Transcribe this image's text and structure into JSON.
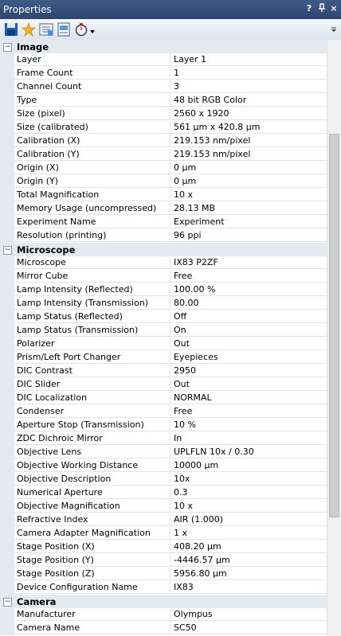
{
  "window": {
    "title": "Properties",
    "help_label": "?",
    "pin_label": "ᵖ",
    "close_label": "×"
  },
  "toolbar": {
    "icons": [
      "save-icon",
      "new-icon",
      "properties-icon",
      "export-icon",
      "timer-icon"
    ],
    "overflow_icon": "dropdown-overflow-icon"
  },
  "colors": {
    "title_bar": "#2f4a74",
    "category_bg": "#e4e9f1",
    "grid_line": "#e0e3e8"
  },
  "sections": [
    {
      "title": "Image",
      "rows": [
        {
          "name": "Layer",
          "value": "Layer 1"
        },
        {
          "name": "Frame Count",
          "value": "1"
        },
        {
          "name": "Channel Count",
          "value": "3"
        },
        {
          "name": "Type",
          "value": "48 bit RGB Color"
        },
        {
          "name": "Size (pixel)",
          "value": "2560 x 1920"
        },
        {
          "name": "Size (calibrated)",
          "value": "561 µm x 420.8 µm"
        },
        {
          "name": "Calibration (X)",
          "value": "219.153 nm/pixel"
        },
        {
          "name": "Calibration (Y)",
          "value": "219.153 nm/pixel"
        },
        {
          "name": "Origin (X)",
          "value": "0 µm"
        },
        {
          "name": "Origin (Y)",
          "value": "0 µm"
        },
        {
          "name": "Total Magnification",
          "value": "10 x"
        },
        {
          "name": "Memory Usage (uncompressed)",
          "value": "28.13 MB"
        },
        {
          "name": "Experiment Name",
          "value": "Experiment"
        },
        {
          "name": "Resolution (printing)",
          "value": "96 ppi"
        }
      ]
    },
    {
      "title": "Microscope",
      "rows": [
        {
          "name": "Microscope",
          "value": "IX83 P2ZF"
        },
        {
          "name": "Mirror Cube",
          "value": "Free"
        },
        {
          "name": "Lamp Intensity (Reflected)",
          "value": "100.00 %"
        },
        {
          "name": "Lamp Intensity (Transmission)",
          "value": "80.00"
        },
        {
          "name": "Lamp Status (Reflected)",
          "value": "Off"
        },
        {
          "name": "Lamp Status (Transmission)",
          "value": "On"
        },
        {
          "name": "Polarizer",
          "value": "Out"
        },
        {
          "name": "Prism/Left Port Changer",
          "value": "Eyepieces"
        },
        {
          "name": "DIC Contrast",
          "value": "2950"
        },
        {
          "name": "DIC Slider",
          "value": "Out"
        },
        {
          "name": "DIC Localization",
          "value": "NORMAL"
        },
        {
          "name": "Condenser",
          "value": "Free"
        },
        {
          "name": "Aperture Stop (Transmission)",
          "value": "10 %"
        },
        {
          "name": "ZDC Dichroic Mirror",
          "value": "In"
        },
        {
          "name": "Objective Lens",
          "value": "UPLFLN 10x / 0.30"
        },
        {
          "name": "Objective Working Distance",
          "value": "10000 µm"
        },
        {
          "name": "Objective Description",
          "value": "10x"
        },
        {
          "name": "Numerical Aperture",
          "value": "0.3"
        },
        {
          "name": "Objective Magnification",
          "value": "10 x"
        },
        {
          "name": "Refractive Index",
          "value": "AIR (1.000)"
        },
        {
          "name": "Camera Adapter Magnification",
          "value": "1 x"
        },
        {
          "name": "Stage Position (X)",
          "value": "408.20 µm"
        },
        {
          "name": "Stage Position (Y)",
          "value": "-4446.57 µm"
        },
        {
          "name": "Stage Position (Z)",
          "value": "5956.80 µm"
        },
        {
          "name": "Device Configuration Name",
          "value": "IX83"
        }
      ]
    },
    {
      "title": "Camera",
      "rows": [
        {
          "name": "Manufacturer",
          "value": "Olympus"
        },
        {
          "name": "Camera Name",
          "value": "SC50"
        }
      ]
    }
  ]
}
